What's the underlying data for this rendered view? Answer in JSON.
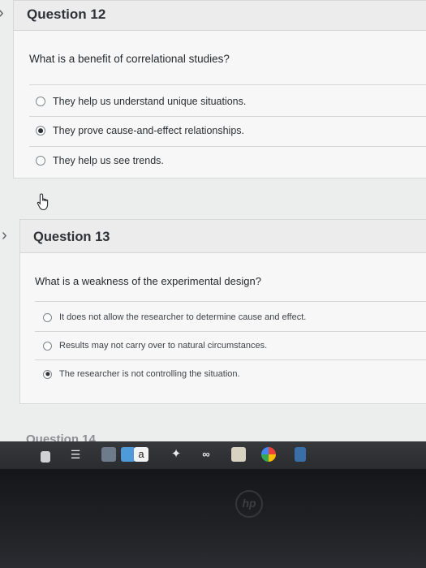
{
  "questions": [
    {
      "title": "Question 12",
      "prompt": "What is a benefit of correlational studies?",
      "options": [
        {
          "label": "They help us understand unique situations.",
          "selected": false
        },
        {
          "label": "They prove cause-and-effect relationships.",
          "selected": true
        },
        {
          "label": "They help us see trends.",
          "selected": false
        }
      ]
    },
    {
      "title": "Question 13",
      "prompt": "What is a weakness of the experimental design?",
      "options": [
        {
          "label": "It does not allow the researcher to determine cause and effect.",
          "selected": false
        },
        {
          "label": "Results may not carry over to natural circumstances.",
          "selected": false
        },
        {
          "label": "The researcher is not controlling the situation.",
          "selected": true
        }
      ]
    },
    {
      "title": "Question 14"
    }
  ],
  "taskbar": {
    "icons": [
      "chrome-icon",
      "docs-icon",
      "folder-icon",
      "amazon-icon",
      "dropbox-icon",
      "link-icon",
      "store-icon",
      "photos-icon"
    ]
  },
  "colors": {
    "accent": "#2e3236",
    "card": "#f7f7f8",
    "header": "#ececed"
  }
}
